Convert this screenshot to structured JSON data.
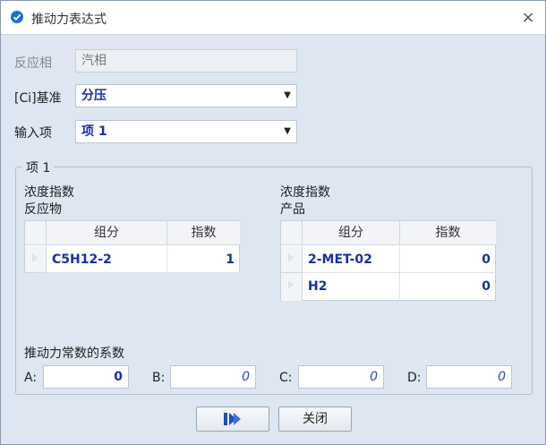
{
  "window": {
    "title": "推动力表达式",
    "close_glyph": "×"
  },
  "form": {
    "phase": {
      "label": "反应相",
      "value": "汽相"
    },
    "basis": {
      "label": "[Ci]基准",
      "value": "分压"
    },
    "input_item": {
      "label": "输入项",
      "value": "项 1"
    }
  },
  "group": {
    "legend": "项 1",
    "reactants": {
      "heading_line1": "浓度指数",
      "heading_line2": "反应物",
      "columns": [
        "组分",
        "指数"
      ],
      "rows": [
        {
          "component": "C5H12-2",
          "exponent": "1"
        }
      ]
    },
    "products": {
      "heading_line1": "浓度指数",
      "heading_line2": "产品",
      "columns": [
        "组分",
        "指数"
      ],
      "rows": [
        {
          "component": "2-MET-02",
          "exponent": "0"
        },
        {
          "component": "H2",
          "exponent": "0"
        }
      ]
    },
    "coefficients": {
      "heading": "推动力常数的系数",
      "A": {
        "label": "A:",
        "value": "0"
      },
      "B": {
        "label": "B:",
        "value": "0"
      },
      "C": {
        "label": "C:",
        "value": "0"
      },
      "D": {
        "label": "D:",
        "value": "0"
      }
    }
  },
  "buttons": {
    "close_label": "关闭",
    "next_icon": "next-arrow-icon"
  },
  "colors": {
    "accent": "#1a2ea8",
    "dialog_bg": "#dde6f1"
  }
}
